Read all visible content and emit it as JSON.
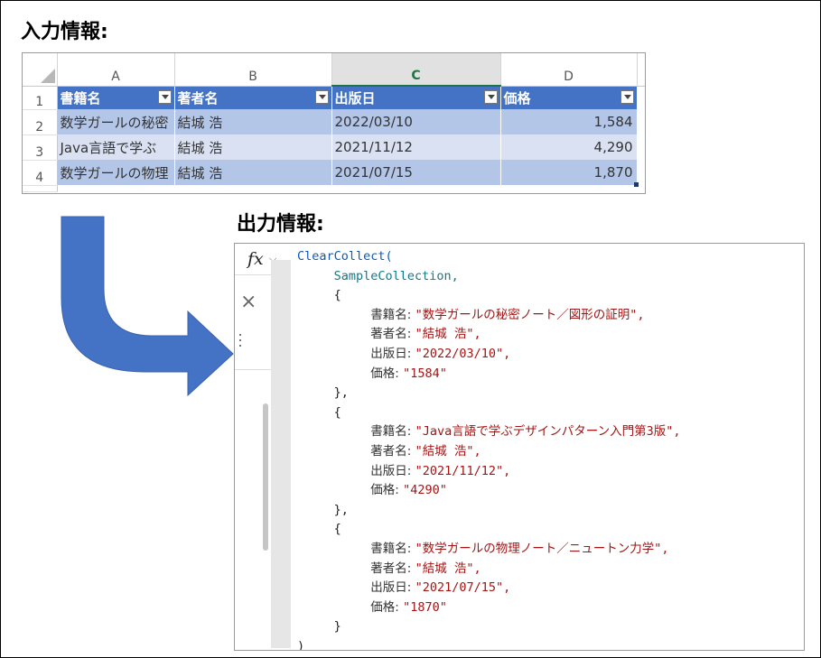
{
  "input_title": "入力情報:",
  "output_title": "出力情報:",
  "sheet": {
    "columns": [
      "A",
      "B",
      "C",
      "D"
    ],
    "selected_column": "C",
    "row_numbers": [
      "1",
      "2",
      "3",
      "4"
    ],
    "headers": [
      "書籍名",
      "著者名",
      "出版日",
      "価格"
    ],
    "rows": [
      [
        "数学ガールの秘密",
        "結城 浩",
        "2022/03/10",
        "1,584"
      ],
      [
        "Java言語で学ぶ",
        "結城 浩",
        "2021/11/12",
        "4,290"
      ],
      [
        "数学ガールの物理",
        "結城 浩",
        "2021/07/15",
        "1,870"
      ]
    ],
    "colors": {
      "header_bg": "#4472c4",
      "band1": "#b4c6e7",
      "band2": "#d9e1f2",
      "selected_col": "#217346"
    }
  },
  "formula_bar": {
    "fx_label": "fx",
    "chevron": "⌵",
    "close": "×",
    "lines": {
      "l1_fn": "ClearCollect(",
      "l2_ident": "SampleCollection,",
      "open": "{",
      "close_comma": "},",
      "close": "}",
      "end": ")",
      "key_title": "書籍名: ",
      "key_author": "著者名: ",
      "key_date": "出版日: ",
      "key_price": "価格: ",
      "r1_title": "\"数学ガールの秘密ノート／図形の証明\",",
      "r1_author": "\"結城 浩\",",
      "r1_date": "\"2022/03/10\",",
      "r1_price": "\"1584\"",
      "r2_title": "\"Java言語で学ぶデザインパターン入門第3版\",",
      "r2_author": "\"結城 浩\",",
      "r2_date": "\"2021/11/12\",",
      "r2_price": "\"4290\"",
      "r3_title": "\"数学ガールの物理ノート／ニュートン力学\",",
      "r3_author": "\"結城 浩\",",
      "r3_date": "\"2021/07/15\",",
      "r3_price": "\"1870\""
    }
  }
}
